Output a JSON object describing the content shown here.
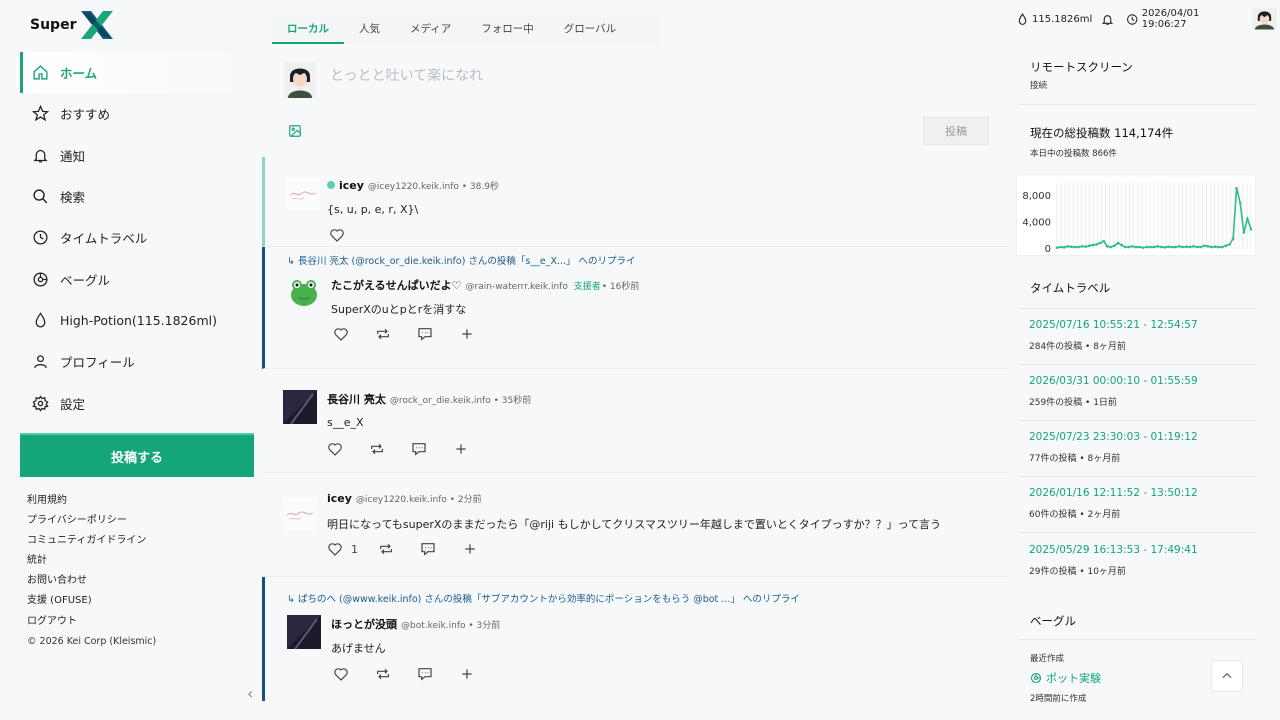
{
  "brand": {
    "super": "Super",
    "x": "X"
  },
  "nav": [
    {
      "label": "ホーム",
      "icon": "home-icon",
      "active": true
    },
    {
      "label": "おすすめ",
      "icon": "star-icon"
    },
    {
      "label": "通知",
      "icon": "bell-icon"
    },
    {
      "label": "検索",
      "icon": "search-icon"
    },
    {
      "label": "タイムトラベル",
      "icon": "clock-icon"
    },
    {
      "label": "ベーグル",
      "icon": "bagel-icon"
    },
    {
      "label": "High-Potion(115.1826ml)",
      "icon": "drop-icon"
    },
    {
      "label": "プロフィール",
      "icon": "user-icon"
    },
    {
      "label": "設定",
      "icon": "gear-icon"
    }
  ],
  "post_button": "投稿する",
  "footer": {
    "links": [
      "利用規約",
      "プライバシーポリシー",
      "コミュニティガイドライン",
      "統計",
      "お問い合わせ",
      "支援 (OFUSE)",
      "ログアウト"
    ],
    "copyright": "© 2026 Kei Corp (Kleismic)"
  },
  "tabs": [
    "ローカル",
    "人気",
    "メディア",
    "フォロー中",
    "グローバル"
  ],
  "composer": {
    "placeholder": "とっとと吐いて楽になれ",
    "send": "投稿"
  },
  "posts": [
    {
      "name": "icey",
      "meta": "@icey1220.keik.info • 38.9秒",
      "body": "{s, u, p, e, r, X}\\",
      "likes": ""
    },
    {
      "reply": "長谷川 亮太 (@rock_or_die.keik.info) さんの投稿「s__e_X...」 へのリプライ",
      "name": "たこがえるせんぱいだよ♡",
      "meta": "@rain-waterrr.keik.info",
      "supporter": "支援者",
      "time": "• 16秒前",
      "body": "SuperXのuとpとrを消すな"
    },
    {
      "name": "長谷川 亮太",
      "meta": "@rock_or_die.keik.info • 35秒前",
      "body": "s__e_X"
    },
    {
      "name": "icey",
      "meta": "@icey1220.keik.info • 2分前",
      "body": "明日になってもsuperXのままだったら「@riji もしかしてクリスマスツリー年越しまで置いとくタイプっすか？？」って言う",
      "likes": "1"
    },
    {
      "reply": "ぱちのへ (@www.keik.info) さんの投稿「サブアカウントから効率的にポーションをもらう @bot ...」 へのリプライ",
      "name": "ほっとが没頭",
      "meta": "@bot.keik.info • 3分前",
      "body": "あげません"
    }
  ],
  "topbar": {
    "potion": "115.1826ml",
    "datetime": "2026/04/01 19:06:27"
  },
  "remote": {
    "title": "リモートスクリーン",
    "status": "接続"
  },
  "stats": {
    "title": "現在の総投稿数 114,174件",
    "today": "本日中の投稿数 866件"
  },
  "chart_data": {
    "type": "line",
    "ylim": [
      0,
      10000
    ],
    "yticks": [
      "8,000",
      "4,000",
      "0"
    ],
    "values": [
      200,
      300,
      250,
      400,
      350,
      300,
      300,
      400,
      350,
      500,
      600,
      700,
      900,
      1200,
      400,
      300,
      500,
      900,
      600,
      300,
      300,
      400,
      300,
      300,
      200,
      300,
      300,
      300,
      400,
      300,
      250,
      350,
      300,
      300,
      400,
      300,
      350,
      300,
      400,
      300,
      300,
      500,
      400,
      300,
      350,
      300,
      300,
      500,
      700,
      1500,
      9200,
      7000,
      2500,
      4600,
      3000
    ]
  },
  "timetravel": {
    "title": "タイムトラベル",
    "items": [
      {
        "range": "2025/07/16 10:55:21 - 12:54:57",
        "count": "284件の投稿 • 8ヶ月前"
      },
      {
        "range": "2026/03/31 00:00:10 - 01:55:59",
        "count": "259件の投稿 • 1日前"
      },
      {
        "range": "2025/07/23 23:30:03 - 01:19:12",
        "count": "77件の投稿 • 8ヶ月前"
      },
      {
        "range": "2026/01/16 12:11:52 - 13:50:12",
        "count": "60件の投稿 • 2ヶ月前"
      },
      {
        "range": "2025/05/29 16:13:53 - 17:49:41",
        "count": "29件の投稿 • 10ヶ月前"
      }
    ]
  },
  "bagel": {
    "title": "ベーグル",
    "recent": "最近作成",
    "item": "ポット実験",
    "created": "2時間前に作成"
  }
}
